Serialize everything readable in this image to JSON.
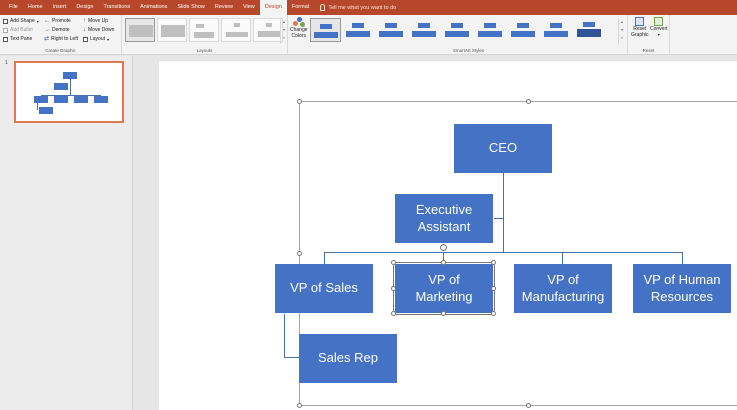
{
  "tabs": [
    "File",
    "Home",
    "Insert",
    "Design",
    "Transitions",
    "Animations",
    "Slide Show",
    "Review",
    "View",
    "Design",
    "Format"
  ],
  "active_tab_index": 9,
  "tell_me": "Tell me what you want to do",
  "ribbon": {
    "create_graphic": {
      "label": "Create Graphic",
      "add_shape": "Add Shape",
      "add_bullet": "Add Bullet",
      "text_pane": "Text Pane",
      "promote": "Promote",
      "demote": "Demote",
      "right_to_left": "Right to Left",
      "move_up": "Move Up",
      "move_down": "Move Down",
      "layout": "Layout"
    },
    "layouts": {
      "label": "Layouts"
    },
    "smartart_styles": {
      "label": "SmartArt Styles",
      "change_colors_1": "Change",
      "change_colors_2": "Colors"
    },
    "reset": {
      "label": "Reset",
      "reset_graphic_1": "Reset",
      "reset_graphic_2": "Graphic",
      "convert": "Convert"
    }
  },
  "slide_number": "1",
  "org_chart": {
    "ceo": "CEO",
    "assistant_1": "Executive",
    "assistant_2": "Assistant",
    "vp_sales": "VP of Sales",
    "vp_marketing_1": "VP of",
    "vp_marketing_2": "Marketing",
    "vp_manufacturing_1": "VP of",
    "vp_manufacturing_2": "Manufacturing",
    "vp_hr_1": "VP of Human",
    "vp_hr_2": "Resources",
    "sales_rep": "Sales Rep"
  },
  "colors": {
    "accent": "#b7472a",
    "node": "#4472c4",
    "thumb_border": "#e2784d"
  }
}
